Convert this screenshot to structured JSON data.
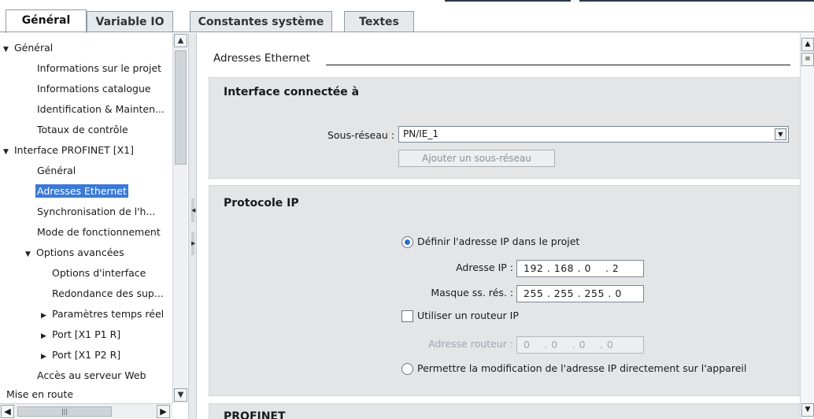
{
  "tabs": [
    {
      "label": "Général",
      "active": true
    },
    {
      "label": "Variable IO",
      "active": false
    },
    {
      "label": "Constantes système",
      "active": false
    },
    {
      "label": "Textes",
      "active": false
    }
  ],
  "tree": {
    "items": [
      {
        "label": "Général",
        "expander": "expanded"
      },
      {
        "label": "Informations sur le projet"
      },
      {
        "label": "Informations catalogue"
      },
      {
        "label": "Identification & Mainten..."
      },
      {
        "label": "Totaux de contrôle"
      },
      {
        "label": "Interface PROFINET [X1]",
        "expander": "expanded"
      },
      {
        "label": "Général"
      },
      {
        "label": "Adresses Ethernet",
        "selected": true
      },
      {
        "label": "Synchronisation de l'h..."
      },
      {
        "label": "Mode de fonctionnement"
      },
      {
        "label": "Options avancées",
        "expander": "expanded"
      },
      {
        "label": "Options d'interface"
      },
      {
        "label": "Redondance des sup..."
      },
      {
        "label": "Paramètres temps réel",
        "expander": "collapsed"
      },
      {
        "label": "Port [X1 P1 R]",
        "expander": "collapsed"
      },
      {
        "label": "Port [X1 P2 R]",
        "expander": "collapsed"
      },
      {
        "label": "Accès au serveur Web"
      },
      {
        "label": "Mise en route"
      }
    ]
  },
  "content": {
    "section_title": "Adresses Ethernet",
    "interface": {
      "title": "Interface connectée à",
      "subnet_label": "Sous-réseau :",
      "subnet_value": "PN/IE_1",
      "add_subnet_button": "Ajouter un sous-réseau"
    },
    "ip_protocol": {
      "title": "Protocole IP",
      "radio_project_label": "Définir l'adresse IP dans le projet",
      "ip_label": "Adresse IP :",
      "ip_value": "192 . 168 . 0    . 2",
      "mask_label": "Masque ss. rés. :",
      "mask_value": "255 . 255 . 255 . 0",
      "router_checkbox_label": "Utiliser un routeur IP",
      "router_label": "Adresse routeur :",
      "router_value": "0    . 0    . 0    . 0",
      "radio_device_label": "Permettre la modification de l'adresse IP directement sur l'appareil"
    },
    "profinet_title": "PROFINET"
  },
  "colors": {
    "selected": "#3a7ad6",
    "radio_dot": "#2a6fc9",
    "box_bg": "#e3e5e7"
  }
}
